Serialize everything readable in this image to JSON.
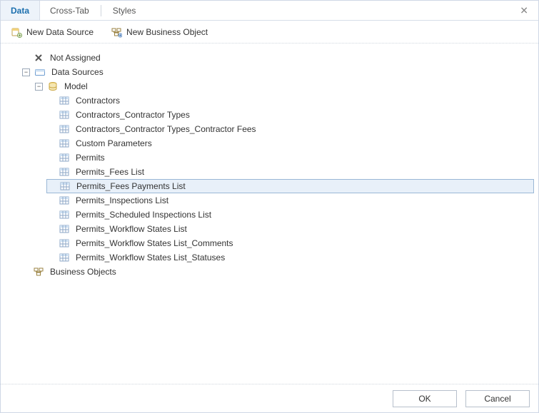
{
  "tabs": {
    "items": [
      {
        "label": "Data",
        "active": true
      },
      {
        "label": "Cross-Tab",
        "active": false
      },
      {
        "label": "Styles",
        "active": false
      }
    ]
  },
  "toolbar": {
    "newDataSource": "New Data Source",
    "newBusinessObject": "New Business Object"
  },
  "tree": {
    "notAssigned": "Not Assigned",
    "dataSources": "Data Sources",
    "model": "Model",
    "modelItems": [
      "Contractors",
      "Contractors_Contractor Types",
      "Contractors_Contractor Types_Contractor Fees",
      "Custom Parameters",
      "Permits",
      "Permits_Fees List",
      "Permits_Fees Payments List",
      "Permits_Inspections List",
      "Permits_Scheduled Inspections List",
      "Permits_Workflow States List",
      "Permits_Workflow States List_Comments",
      "Permits_Workflow States List_Statuses"
    ],
    "selectedIndex": 6,
    "businessObjects": "Business Objects"
  },
  "footer": {
    "ok": "OK",
    "cancel": "Cancel"
  }
}
